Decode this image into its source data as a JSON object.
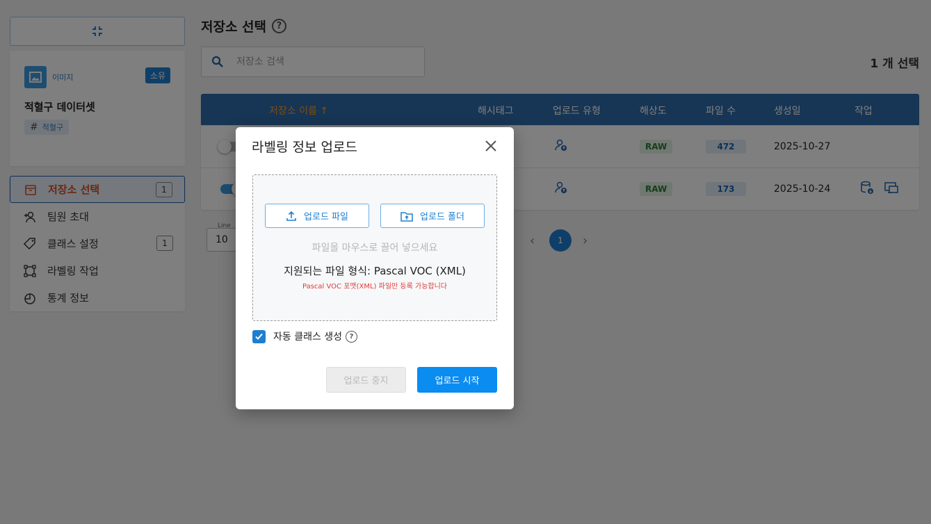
{
  "sidebar": {
    "dataset": {
      "type_label": "이미지",
      "owner_badge": "소유",
      "name": "적혈구 데이터셋",
      "tag": "적혈구"
    },
    "menu": [
      {
        "label": "저장소 선택",
        "count": "1",
        "icon": "storage-icon"
      },
      {
        "label": "팀원 초대",
        "count": "",
        "icon": "person-add-icon"
      },
      {
        "label": "클래스 설정",
        "count": "1",
        "icon": "tag-icon"
      },
      {
        "label": "라벨링 작업",
        "count": "",
        "icon": "bounding-box-icon"
      },
      {
        "label": "통계 정보",
        "count": "",
        "icon": "pie-chart-icon"
      }
    ]
  },
  "main": {
    "title": "저장소 선택",
    "search_placeholder": "저장소 검색",
    "selected_count": "1 개 선택",
    "table": {
      "headers": {
        "name": "저장소 이름",
        "hashtag": "해시태그",
        "upload_type": "업로드 유형",
        "resolution": "해상도",
        "file_count": "파일 수",
        "created": "생성일",
        "actions": "작업"
      },
      "rows": [
        {
          "selected": false,
          "resolution": "RAW",
          "file_count": "472",
          "created": "2025-10-27"
        },
        {
          "selected": true,
          "resolution": "RAW",
          "file_count": "173",
          "created": "2025-10-24"
        }
      ]
    },
    "pagination": {
      "line_label": "Line",
      "page_size": "10",
      "current_page": "1"
    }
  },
  "modal": {
    "title": "라벨링 정보 업로드",
    "upload_file_label": "업로드 파일",
    "upload_folder_label": "업로드 폴더",
    "drop_hint": "파일을 마우스로 끌어 넣으세요",
    "supported_format": "지원되는 파일 형식: Pascal VOC (XML)",
    "format_warning": "Pascal VOC 포맷(XML) 파일만 등록 가능합니다",
    "auto_class_label": "자동 클래스 생성",
    "auto_class_checked": true,
    "stop_label": "업로드 중지",
    "start_label": "업로드 시작"
  },
  "colors": {
    "primary": "#1e7fd0",
    "table_header": "#2e6aa8",
    "active_menu_text": "#d4502a",
    "warning": "#e03b3b"
  }
}
